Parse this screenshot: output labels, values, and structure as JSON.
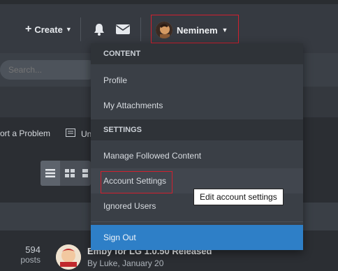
{
  "header": {
    "create_label": "Create",
    "username": "Neminem"
  },
  "search": {
    "placeholder": "Search..."
  },
  "toolbar": {
    "report_label": "ort a Problem",
    "un_label": "Un"
  },
  "topic": {
    "post_count": "594",
    "post_label": "posts",
    "title": "Emby for LG 1.0.50 Released",
    "meta": "By Luke, January 20"
  },
  "menu": {
    "content_header": "CONTENT",
    "profile": "Profile",
    "attachments": "My Attachments",
    "settings_header": "SETTINGS",
    "followed": "Manage Followed Content",
    "account": "Account Settings",
    "ignored": "Ignored Users",
    "signout": "Sign Out"
  },
  "tooltip": {
    "text": "Edit account settings"
  },
  "colors": {
    "accent": "#2e7fc7",
    "highlight": "#d1202f"
  }
}
